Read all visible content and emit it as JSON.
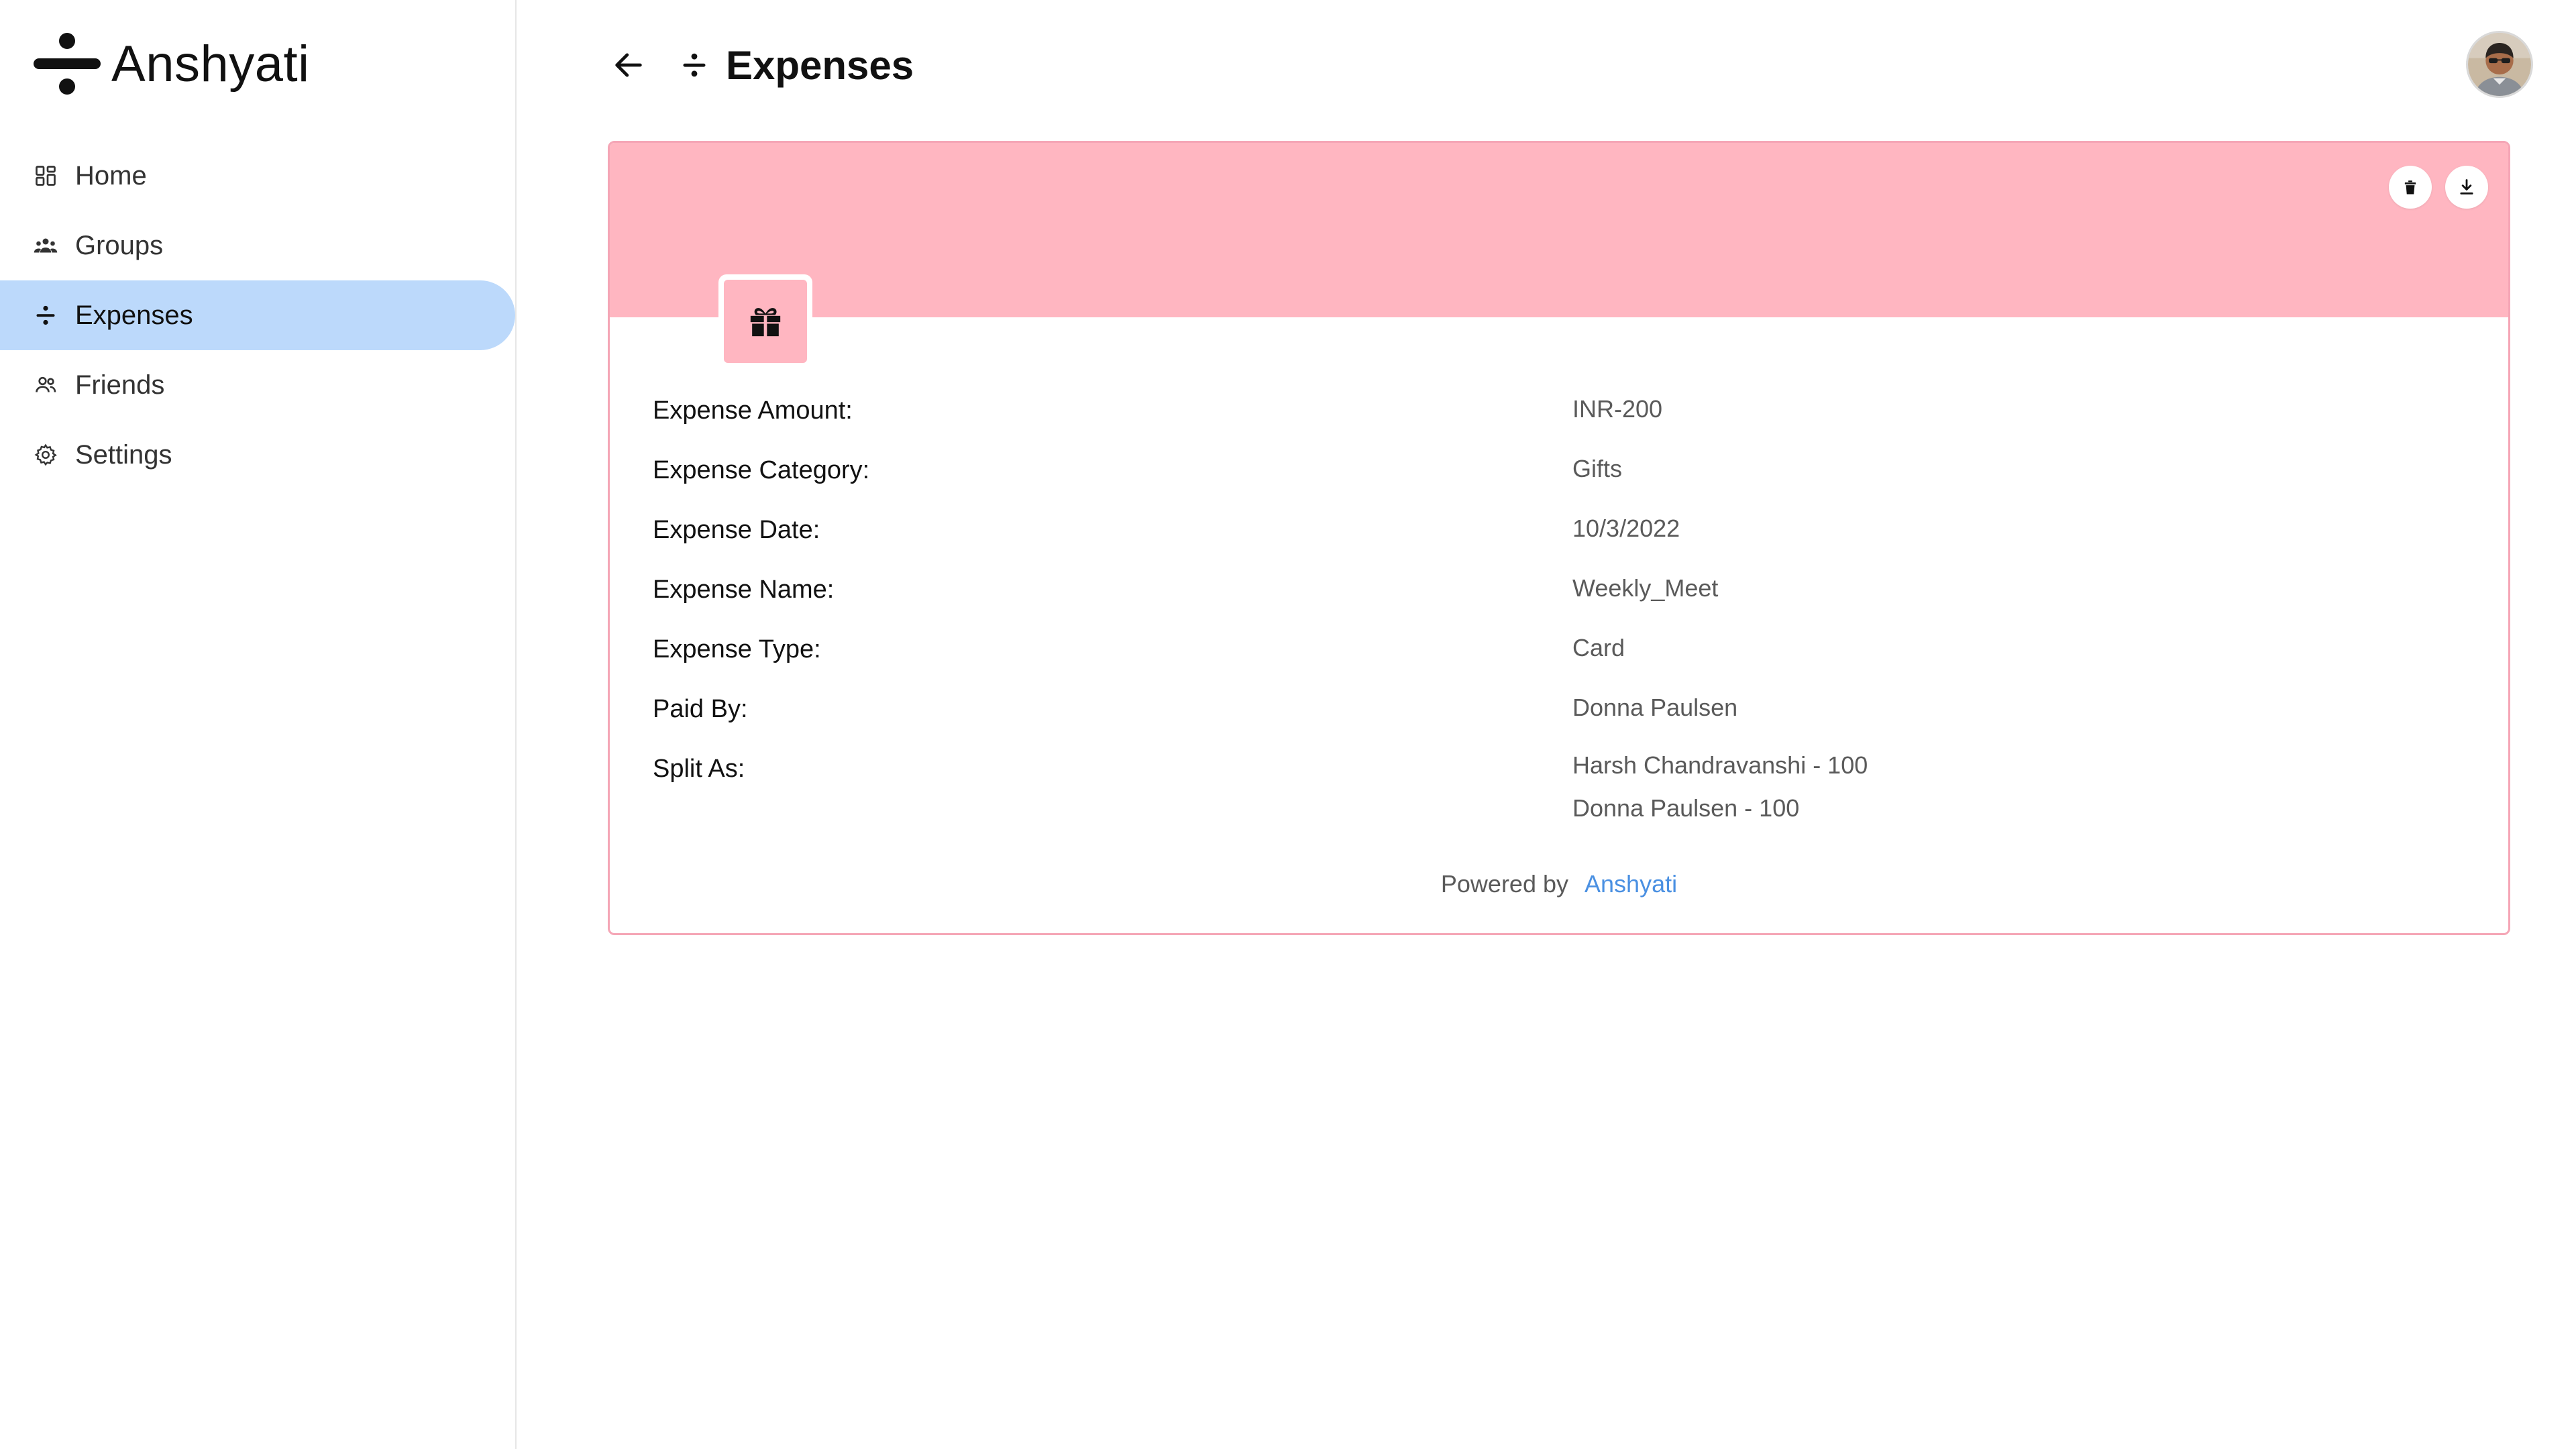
{
  "brand": {
    "name": "Anshyati",
    "logo_icon": "divide-icon"
  },
  "sidebar": {
    "items": [
      {
        "label": "Home",
        "icon": "dashboard-icon",
        "active": false
      },
      {
        "label": "Groups",
        "icon": "groups-icon",
        "active": false
      },
      {
        "label": "Expenses",
        "icon": "divide-icon",
        "active": true
      },
      {
        "label": "Friends",
        "icon": "people-icon",
        "active": false
      },
      {
        "label": "Settings",
        "icon": "gear-icon",
        "active": false
      }
    ],
    "active_color": "#bcd9fb"
  },
  "header": {
    "title": "Expenses",
    "back_icon": "arrow-left-icon",
    "title_icon": "divide-icon",
    "avatar_icon": "user-avatar-photo"
  },
  "card": {
    "banner_color": "#ffb6c1",
    "border_color": "#f5a6b6",
    "category_icon": "gift-icon",
    "actions": [
      {
        "name": "delete",
        "icon": "trash-icon"
      },
      {
        "name": "download",
        "icon": "download-icon"
      }
    ],
    "details": {
      "amount": {
        "label": "Expense Amount:",
        "value": "INR-200"
      },
      "category": {
        "label": "Expense Category:",
        "value": "Gifts"
      },
      "date": {
        "label": "Expense Date:",
        "value": "10/3/2022"
      },
      "name": {
        "label": "Expense Name:",
        "value": "Weekly_Meet"
      },
      "type": {
        "label": "Expense Type:",
        "value": "Card"
      },
      "paid_by": {
        "label": "Paid By:",
        "value": "Donna Paulsen"
      },
      "split_as": {
        "label": "Split As:",
        "values": [
          "Harsh Chandravanshi - 100",
          "Donna Paulsen - 100"
        ]
      }
    },
    "footer": {
      "powered_by": "Powered by",
      "brand": "Anshyati",
      "brand_color": "#4a90e2"
    }
  }
}
